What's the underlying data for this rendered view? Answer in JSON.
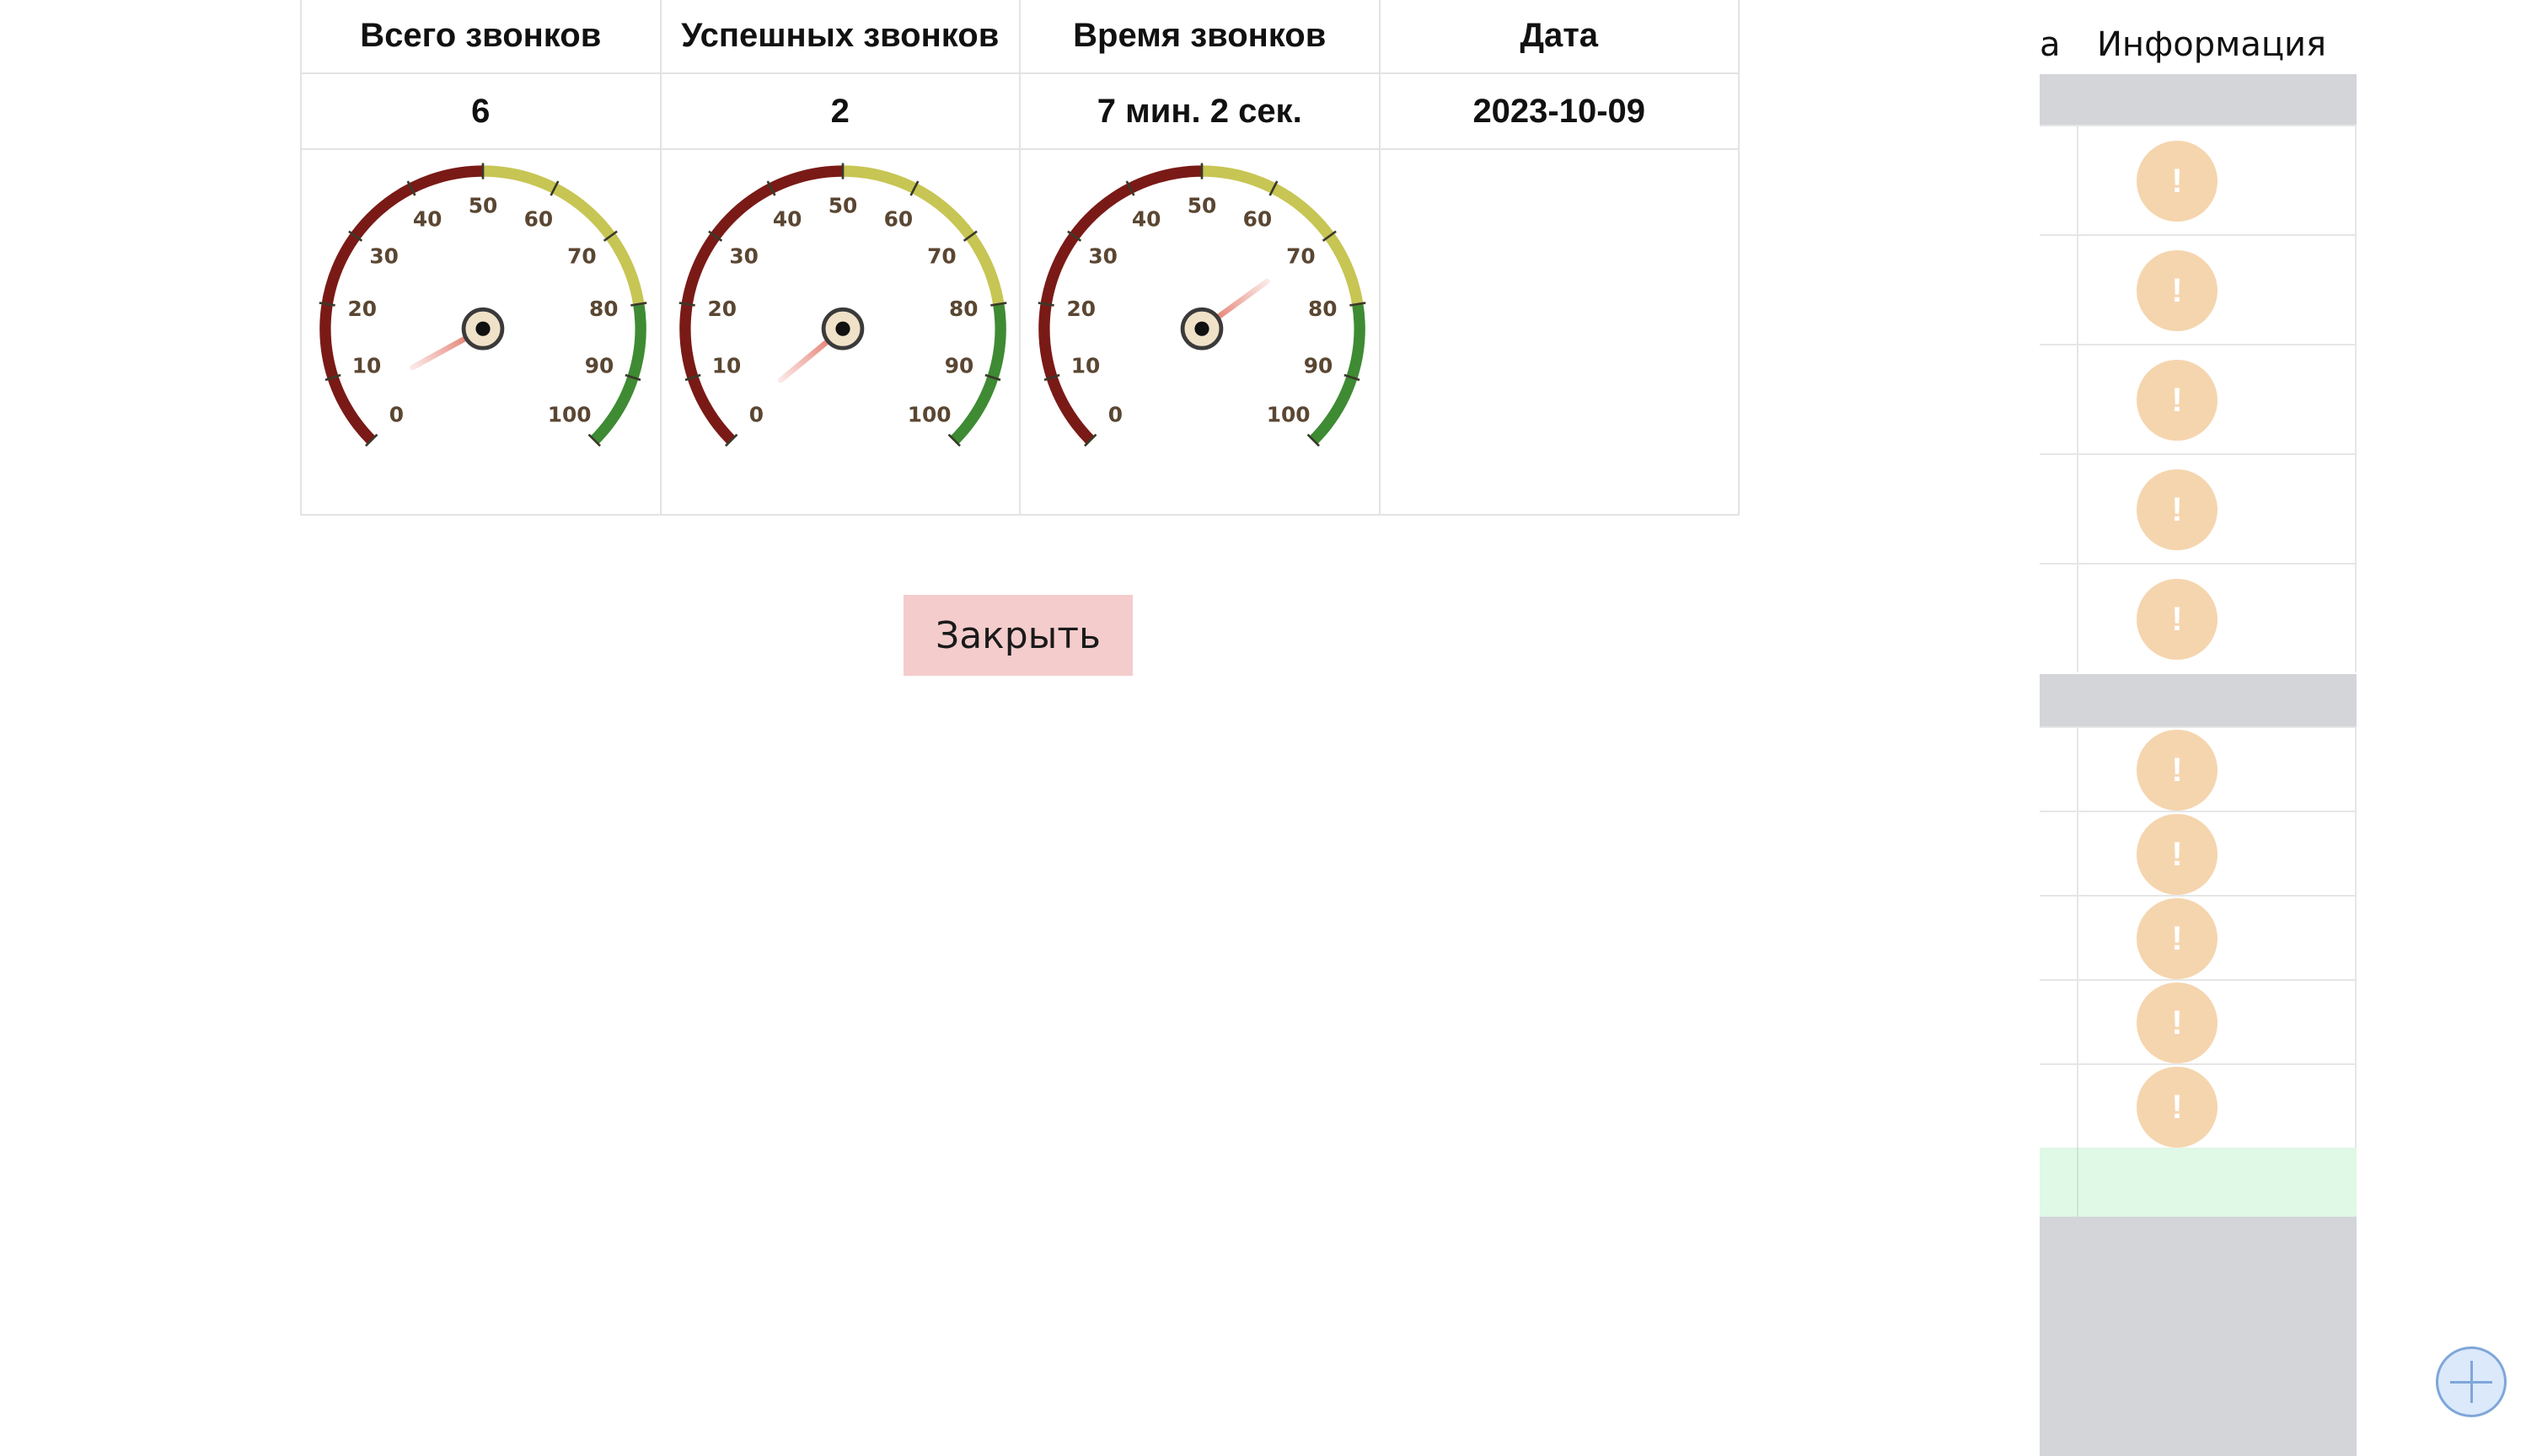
{
  "stats_table": {
    "headers": [
      "Всего звонков",
      "Успешных звонков",
      "Время звонков",
      "Дата"
    ],
    "values": [
      "6",
      "2",
      "7 мин. 2 сек.",
      "2023-10-09"
    ]
  },
  "gauges": {
    "tick_labels": [
      "0",
      "10",
      "20",
      "30",
      "40",
      "50",
      "60",
      "70",
      "80",
      "90",
      "100"
    ],
    "needle_values": [
      6,
      2,
      70
    ],
    "colors": {
      "red_zone": "#7a1a16",
      "yellow_zone": "#c7c553",
      "green_zone": "#3e8b33",
      "needle": "#e06a5a"
    }
  },
  "close_button": {
    "label": "Закрыть"
  },
  "side_panel": {
    "partial_header": "а",
    "info_header": "Информация",
    "warning_icon_text": "!",
    "warning_count_group1": 5,
    "warning_count_group2": 5
  },
  "fab": {
    "icon": "plus-icon"
  }
}
